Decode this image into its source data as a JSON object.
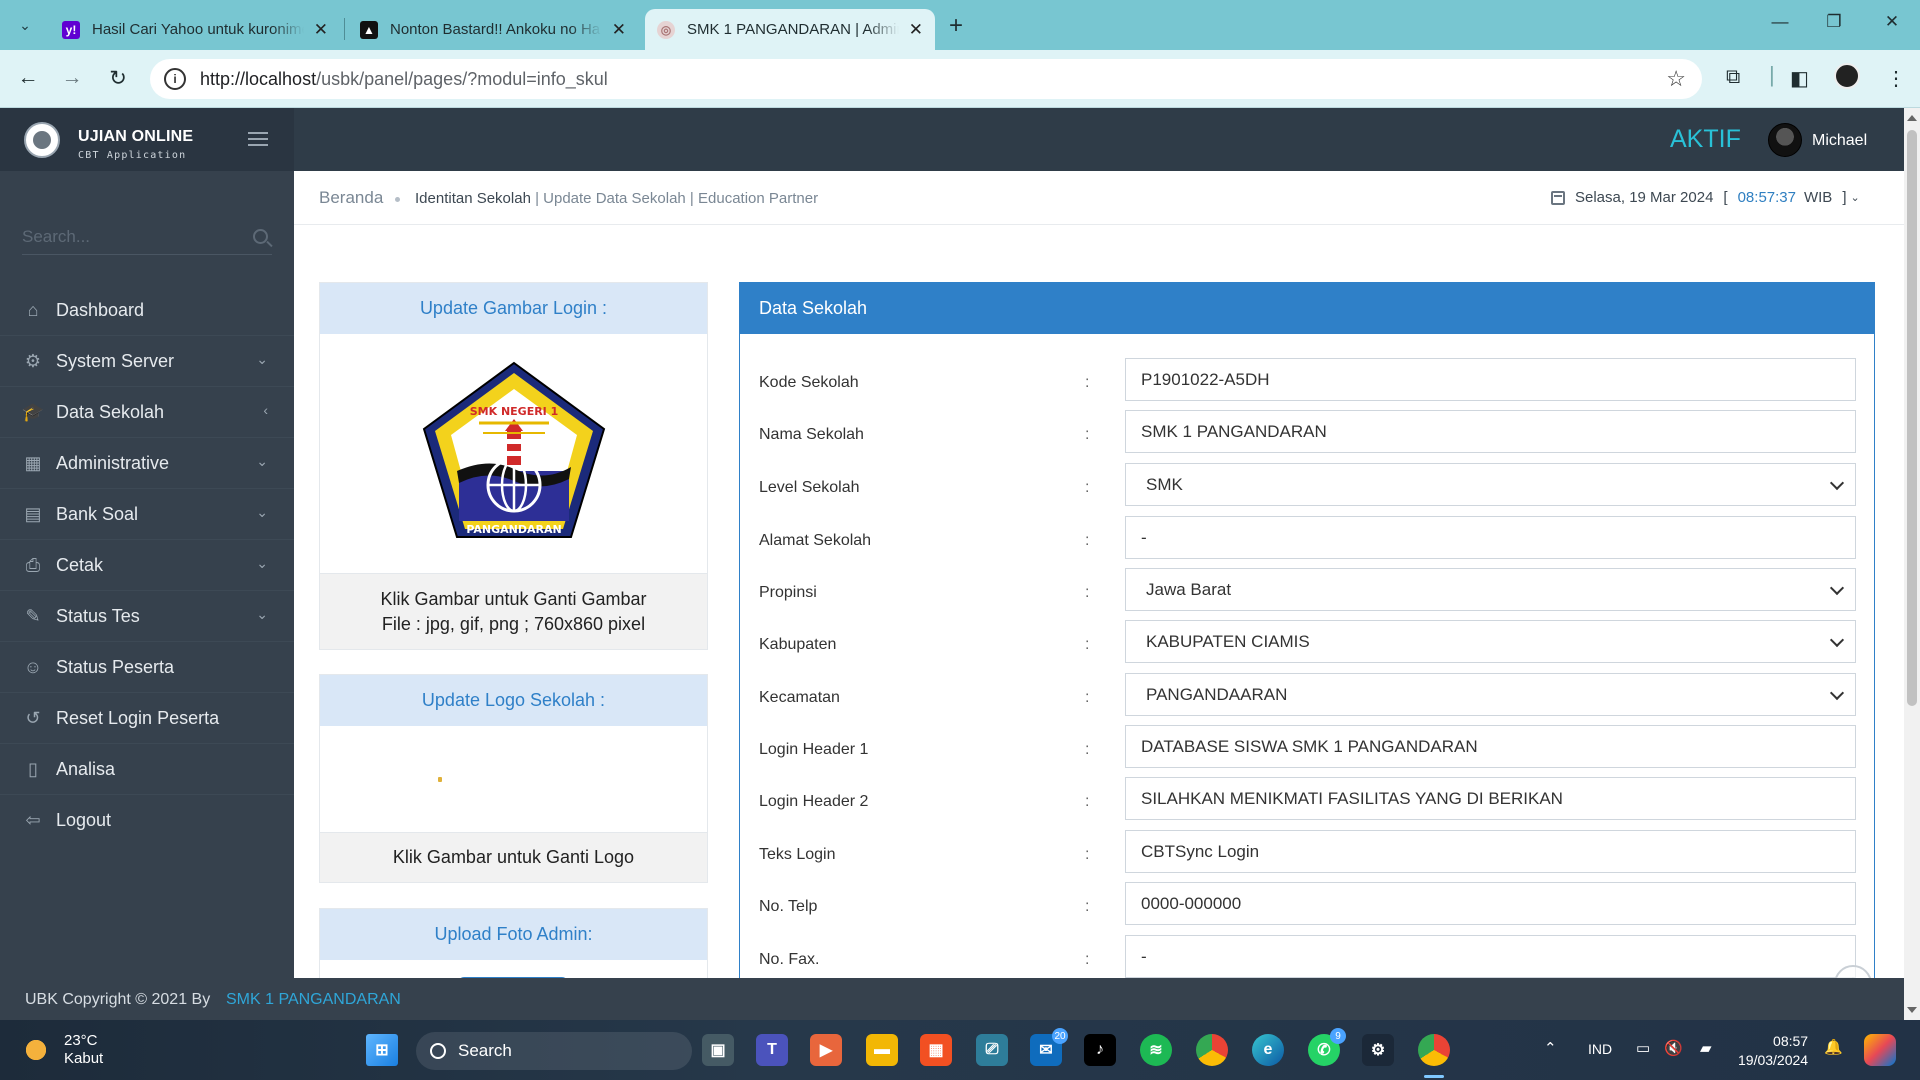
{
  "browser": {
    "tabs": [
      {
        "title": "Hasil Cari Yahoo untuk kuronime",
        "favicon": "yahoo-icon",
        "color": "#6001d2"
      },
      {
        "title": "Nonton Bastard!! Ankoku no Ha",
        "favicon": "anime-site-icon",
        "color": "#111111"
      },
      {
        "title": "SMK 1 PANGANDARAN | Admin",
        "favicon": "site-icon",
        "color": "#c9a7a7"
      }
    ],
    "url_host": "http://localhost",
    "url_path": "/usbk/panel/pages/?modul=info_skul"
  },
  "header": {
    "brand_title": "UJIAN ONLINE",
    "brand_subtitle": "CBT Application",
    "status": "AKTIF",
    "user_name": "Michael",
    "accent_color": "#29c1d7"
  },
  "sidebar": {
    "search_placeholder": "Search...",
    "items": [
      {
        "label": "Dashboard",
        "icon": "home-icon",
        "chevron": ""
      },
      {
        "label": "System Server",
        "icon": "gear-icon",
        "chevron": "⌄"
      },
      {
        "label": "Data Sekolah",
        "icon": "graduation-cap-icon",
        "chevron": "‹"
      },
      {
        "label": "Administrative",
        "icon": "grid-icon",
        "chevron": "⌄"
      },
      {
        "label": "Bank Soal",
        "icon": "book-icon",
        "chevron": "⌄"
      },
      {
        "label": "Cetak",
        "icon": "printer-icon",
        "chevron": "⌄"
      },
      {
        "label": "Status Tes",
        "icon": "edit-icon",
        "chevron": "⌄"
      },
      {
        "label": "Status Peserta",
        "icon": "user-icon",
        "chevron": ""
      },
      {
        "label": "Reset Login Peserta",
        "icon": "refresh-icon",
        "chevron": ""
      },
      {
        "label": "Analisa",
        "icon": "tablet-icon",
        "chevron": ""
      },
      {
        "label": "Logout",
        "icon": "logout-icon",
        "chevron": ""
      }
    ]
  },
  "breadcrumb": {
    "home": "Beranda",
    "current": "Identitan Sekolah",
    "sep1": " | ",
    "item2": "Update Data Sekolah",
    "sep2": " | ",
    "item3": "Education Partner"
  },
  "date": {
    "day": "Selasa, 19 Mar 2024",
    "open_bracket": "[",
    "time": "08:57:37",
    "tz": "WIB",
    "close_bracket": "]"
  },
  "cards": {
    "login_image": {
      "title": "Update Gambar Login :",
      "caption_line1": "Klik Gambar untuk Ganti Gambar",
      "caption_line2": "File : jpg, gif, png ; 760x860 pixel",
      "logo_text_top": "SMK NEGERI 1",
      "logo_text_bottom": "PANGANDARAN"
    },
    "school_logo": {
      "title": "Update Logo Sekolah :",
      "caption": "Klik Gambar untuk Ganti Logo"
    },
    "admin_photo": {
      "title": "Upload Foto Admin:"
    }
  },
  "form": {
    "title": "Data Sekolah",
    "colon": ":",
    "fields": [
      {
        "label": "Kode Sekolah",
        "value": "P1901022-A5DH",
        "type": "text"
      },
      {
        "label": "Nama Sekolah",
        "value": "SMK 1 PANGANDARAN",
        "type": "text"
      },
      {
        "label": "Level Sekolah",
        "value": "SMK",
        "type": "select"
      },
      {
        "label": "Alamat Sekolah",
        "value": "-",
        "type": "text"
      },
      {
        "label": "Propinsi",
        "value": "Jawa Barat",
        "type": "select"
      },
      {
        "label": "Kabupaten",
        "value": "KABUPATEN CIAMIS",
        "type": "select"
      },
      {
        "label": "Kecamatan",
        "value": "PANGANDAARAN",
        "type": "select"
      },
      {
        "label": "Login Header 1",
        "value": "DATABASE SISWA SMK 1 PANGANDARAN",
        "type": "text"
      },
      {
        "label": "Login Header 2",
        "value": "SILAHKAN MENIKMATI FASILITAS YANG DI BERIKAN",
        "type": "text"
      },
      {
        "label": "Teks Login",
        "value": "CBTSync Login",
        "type": "text"
      },
      {
        "label": "No. Telp",
        "value": "0000-000000",
        "type": "text"
      },
      {
        "label": "No. Fax.",
        "value": "-",
        "type": "text"
      }
    ]
  },
  "footer": {
    "copyright": "UBK Copyright © 2021 By",
    "school": "SMK 1 PANGANDARAN"
  },
  "taskbar": {
    "temperature": "23°C",
    "weather": "Kabut",
    "search_label": "Search",
    "language": "IND",
    "time": "08:57",
    "date": "19/03/2024",
    "teams_badge": "20",
    "whatsapp_badge": "9"
  }
}
